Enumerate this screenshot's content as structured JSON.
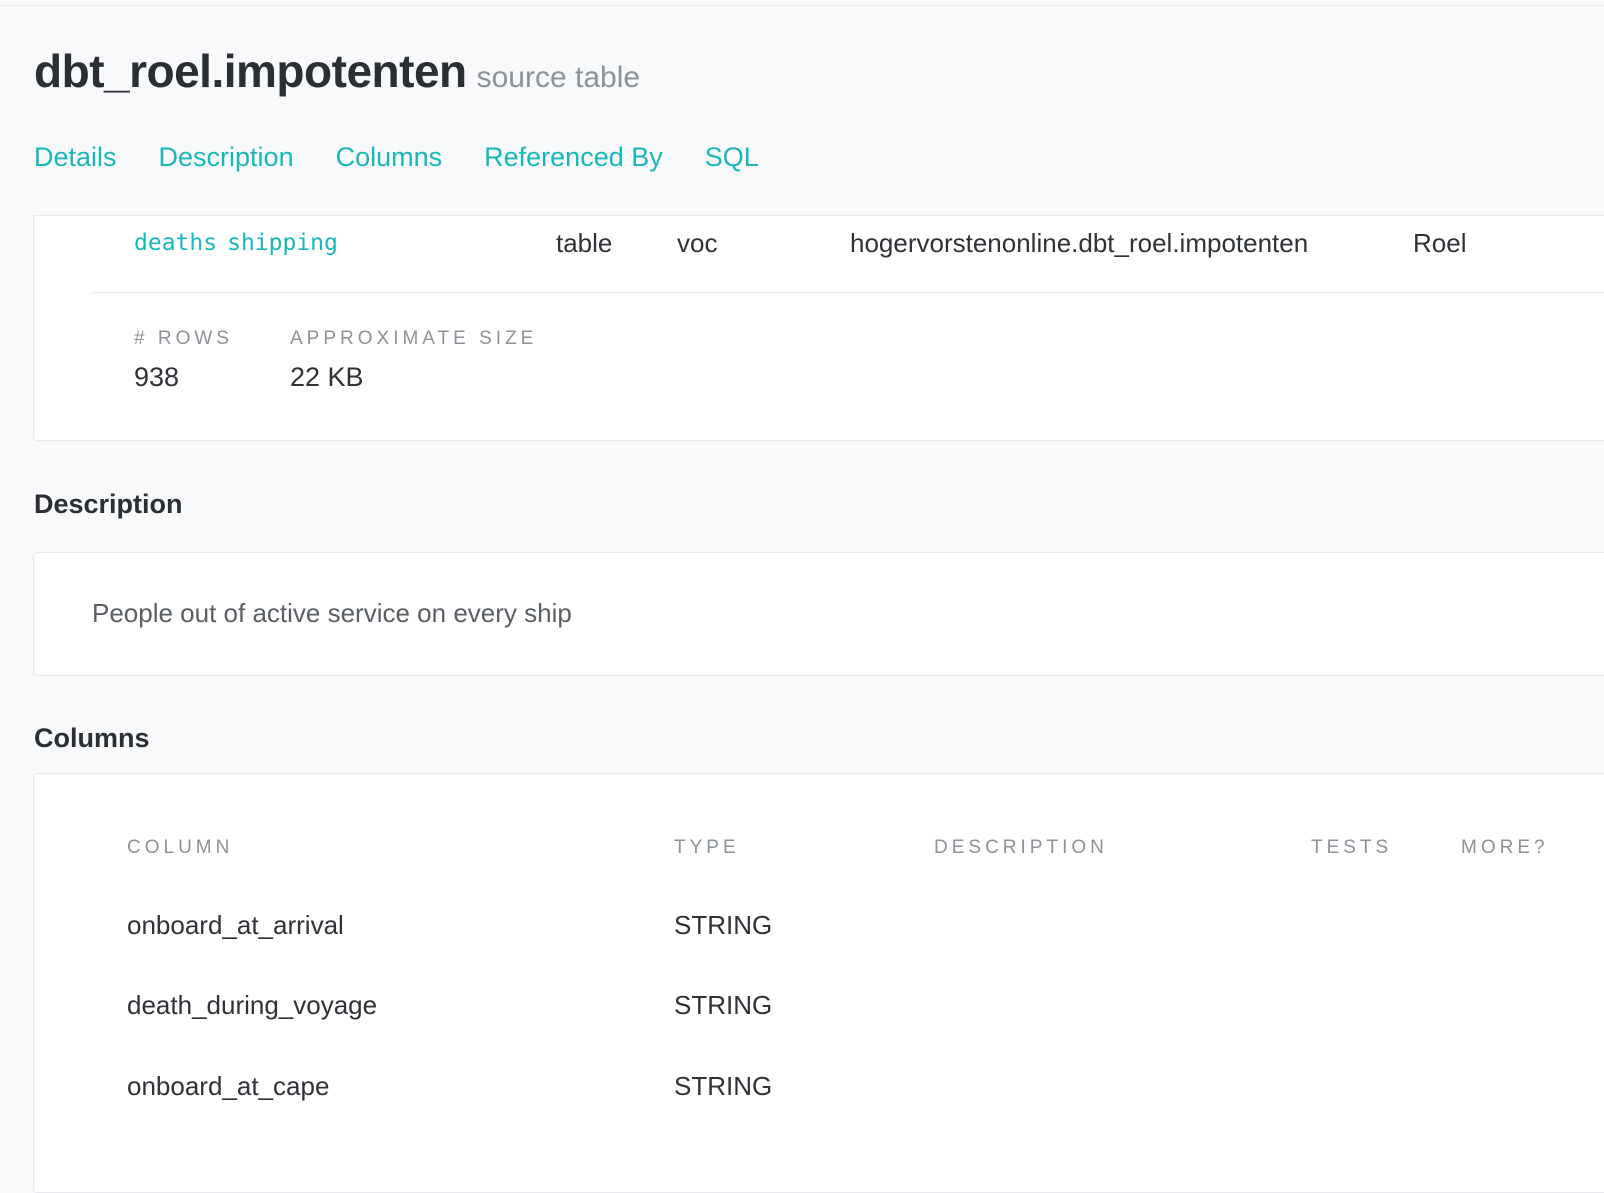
{
  "header": {
    "title": "dbt_roel.impotenten",
    "subtitle": "source table"
  },
  "tabs": [
    {
      "label": "Details"
    },
    {
      "label": "Description"
    },
    {
      "label": "Columns"
    },
    {
      "label": "Referenced By"
    },
    {
      "label": "SQL"
    }
  ],
  "details": {
    "tags": [
      "deaths",
      "shipping"
    ],
    "type": "table",
    "package": "voc",
    "relation": "hogervorstenonline.dbt_roel.impotenten",
    "owner": "Roel",
    "stats": [
      {
        "label": "# ROWS",
        "value": "938"
      },
      {
        "label": "APPROXIMATE SIZE",
        "value": "22 KB"
      }
    ]
  },
  "description": {
    "heading": "Description",
    "text": "People out of active service on every ship"
  },
  "columns": {
    "heading": "Columns",
    "headers": {
      "column": "COLUMN",
      "type": "TYPE",
      "description": "DESCRIPTION",
      "tests": "TESTS",
      "more": "MORE?"
    },
    "rows": [
      {
        "name": "onboard_at_arrival",
        "type": "STRING"
      },
      {
        "name": "death_during_voyage",
        "type": "STRING"
      },
      {
        "name": "onboard_at_cape",
        "type": "STRING"
      }
    ]
  },
  "colors": {
    "accent": "#19b8b8",
    "background": "#f8f9fb",
    "card": "#ffffff",
    "muted": "#8c929a"
  }
}
